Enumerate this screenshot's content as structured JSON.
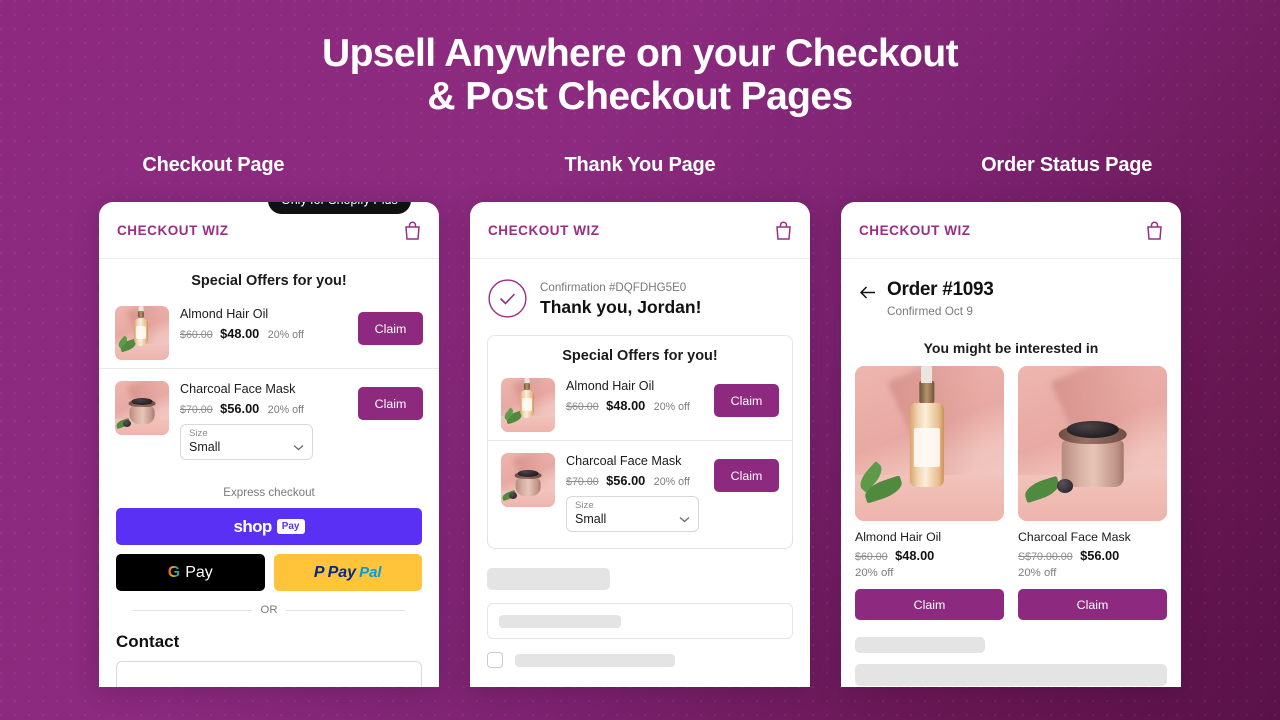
{
  "hero": {
    "line1": "Upsell Anywhere on your Checkout",
    "line2": "& Post Checkout Pages"
  },
  "column_titles": [
    "Checkout Page",
    "Thank You Page",
    "Order Status Page"
  ],
  "badge": {
    "label": "Only for Shopify Plus"
  },
  "brand": {
    "name": "CHECKOUT WIZ",
    "icon": "shopping-bag-icon",
    "color": "#9b2d86"
  },
  "accent_color": "#8e2980",
  "offers": {
    "title": "Special Offers for you!",
    "claim_label": "Claim",
    "items": [
      {
        "name": "Almond Hair Oil",
        "old_price": "$60.00",
        "price": "$48.00",
        "discount": "20% off",
        "image": "almond-hair-oil-photo",
        "has_variant": false
      },
      {
        "name": "Charcoal Face Mask",
        "old_price": "$70.00",
        "price": "$56.00",
        "discount": "20% off",
        "image": "charcoal-face-mask-photo",
        "has_variant": true,
        "variant_label": "Size",
        "variant_value": "Small"
      }
    ]
  },
  "checkout_page": {
    "express_label": "Express checkout",
    "shop_pay": {
      "word": "shop",
      "pill": "Pay"
    },
    "google_pay": {
      "g": "G",
      "label": "Pay"
    },
    "paypal": {
      "first": "Pay",
      "second": "Pal"
    },
    "or_label": "OR",
    "contact_heading": "Contact"
  },
  "thank_you_page": {
    "confirmation": "Confirmation #DQFDHG5E0",
    "thanks": "Thank you, Jordan!",
    "check_icon": "check-circle-icon"
  },
  "order_status_page": {
    "back_icon": "back-arrow-icon",
    "order_title": "Order #1093",
    "confirmed": "Confirmed Oct 9",
    "interested_title": "You might be interested in",
    "claim_label": "Claim",
    "products": [
      {
        "name": "Almond Hair Oil",
        "old_price": "$60.00",
        "price": "$48.00",
        "discount": "20% off",
        "image": "almond-hair-oil-photo"
      },
      {
        "name": "Charcoal Face Mask",
        "old_price": "S$70.00.00",
        "price": "$56.00",
        "discount": "20% off",
        "image": "charcoal-face-mask-photo"
      }
    ]
  }
}
